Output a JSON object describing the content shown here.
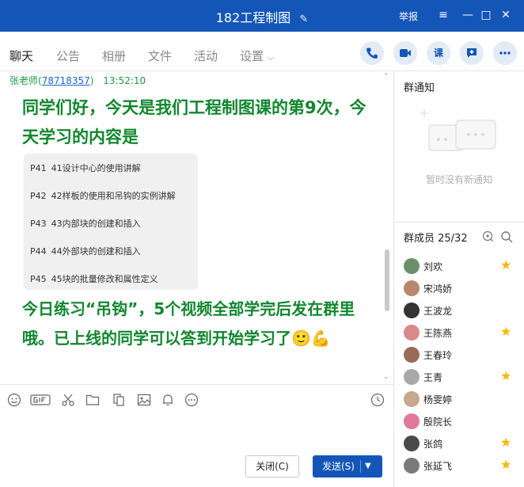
{
  "window": {
    "title": "182工程制图",
    "report": "举报",
    "controls": {
      "menu": "≡",
      "minimize": "—",
      "maximize": "□",
      "close": "✕"
    }
  },
  "tabs": [
    "聊天",
    "公告",
    "相册",
    "文件",
    "活动",
    "设置"
  ],
  "toolbar": {
    "course_label": "课"
  },
  "chat": {
    "sender": {
      "name": "张老师",
      "qq": "78718357",
      "time": "13:52:10"
    },
    "message1": "同学们好，今天是我们工程制图课的第9次，今天学习的内容是",
    "playlist": [
      {
        "p": "P41",
        "title": "41设计中心的使用讲解"
      },
      {
        "p": "P42",
        "title": "42样板的使用和吊钩的实例讲解"
      },
      {
        "p": "P43",
        "title": "43内部块的创建和插入"
      },
      {
        "p": "P44",
        "title": "44外部块的创建和插入"
      },
      {
        "p": "P45",
        "title": "45块的批量修改和属性定义"
      }
    ],
    "message2": " 今日练习“吊钩”，5个视频全部学完后发在群里哦。已上线的同学可以答到开始学习了🙂💪"
  },
  "input": {
    "close_label": "关闭(C)",
    "send_label": "发送(S)"
  },
  "notice": {
    "heading": "群通知",
    "empty_text": "暂时没有新通知"
  },
  "members": {
    "heading": "群成员 25/32",
    "list": [
      {
        "name": "刘欢",
        "star": true,
        "color": "#6a8f6a"
      },
      {
        "name": "宋鸿娇",
        "star": false,
        "color": "#b9876b"
      },
      {
        "name": "王波龙",
        "star": false,
        "color": "#333333"
      },
      {
        "name": "王陈燕",
        "star": true,
        "color": "#d98a8a"
      },
      {
        "name": "王春玲",
        "star": false,
        "color": "#9a6b5a"
      },
      {
        "name": "王青",
        "star": true,
        "color": "#a8a8a8"
      },
      {
        "name": "杨雯婷",
        "star": false,
        "color": "#c7a88c"
      },
      {
        "name": "殷院长",
        "star": false,
        "color": "#e07a9a"
      },
      {
        "name": "张鸽",
        "star": true,
        "color": "#4a4a4a"
      },
      {
        "name": "张延飞",
        "star": true,
        "color": "#7a7a7a"
      }
    ],
    "star_glyph": "★"
  }
}
